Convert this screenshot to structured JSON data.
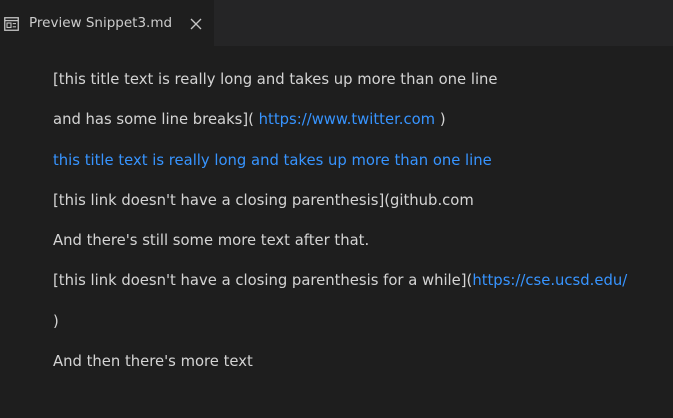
{
  "tab": {
    "icon": "preview-icon",
    "label": "Preview Snippet3.md",
    "close_icon": "close-icon"
  },
  "preview": {
    "line1": "[this title text is really long and takes up more than one line",
    "line2_text": "and has some line breaks](",
    "line2_link": "https://www.twitter.com",
    "line2_after": ")",
    "line3_link": "this title text is really long and takes up more than one line",
    "line4": "[this link doesn't have a closing parenthesis](github.com",
    "line5": "And there's still some more text after that.",
    "line6_text": "[this link doesn't have a closing parenthesis for a while](",
    "line6_link": "https://cse.ucsd.edu/",
    "line7": ")",
    "line8": "And then there's more text"
  },
  "colors": {
    "background": "#1e1e1e",
    "tabbar": "#252526",
    "text": "#d4d4d4",
    "link": "#3794ff"
  }
}
